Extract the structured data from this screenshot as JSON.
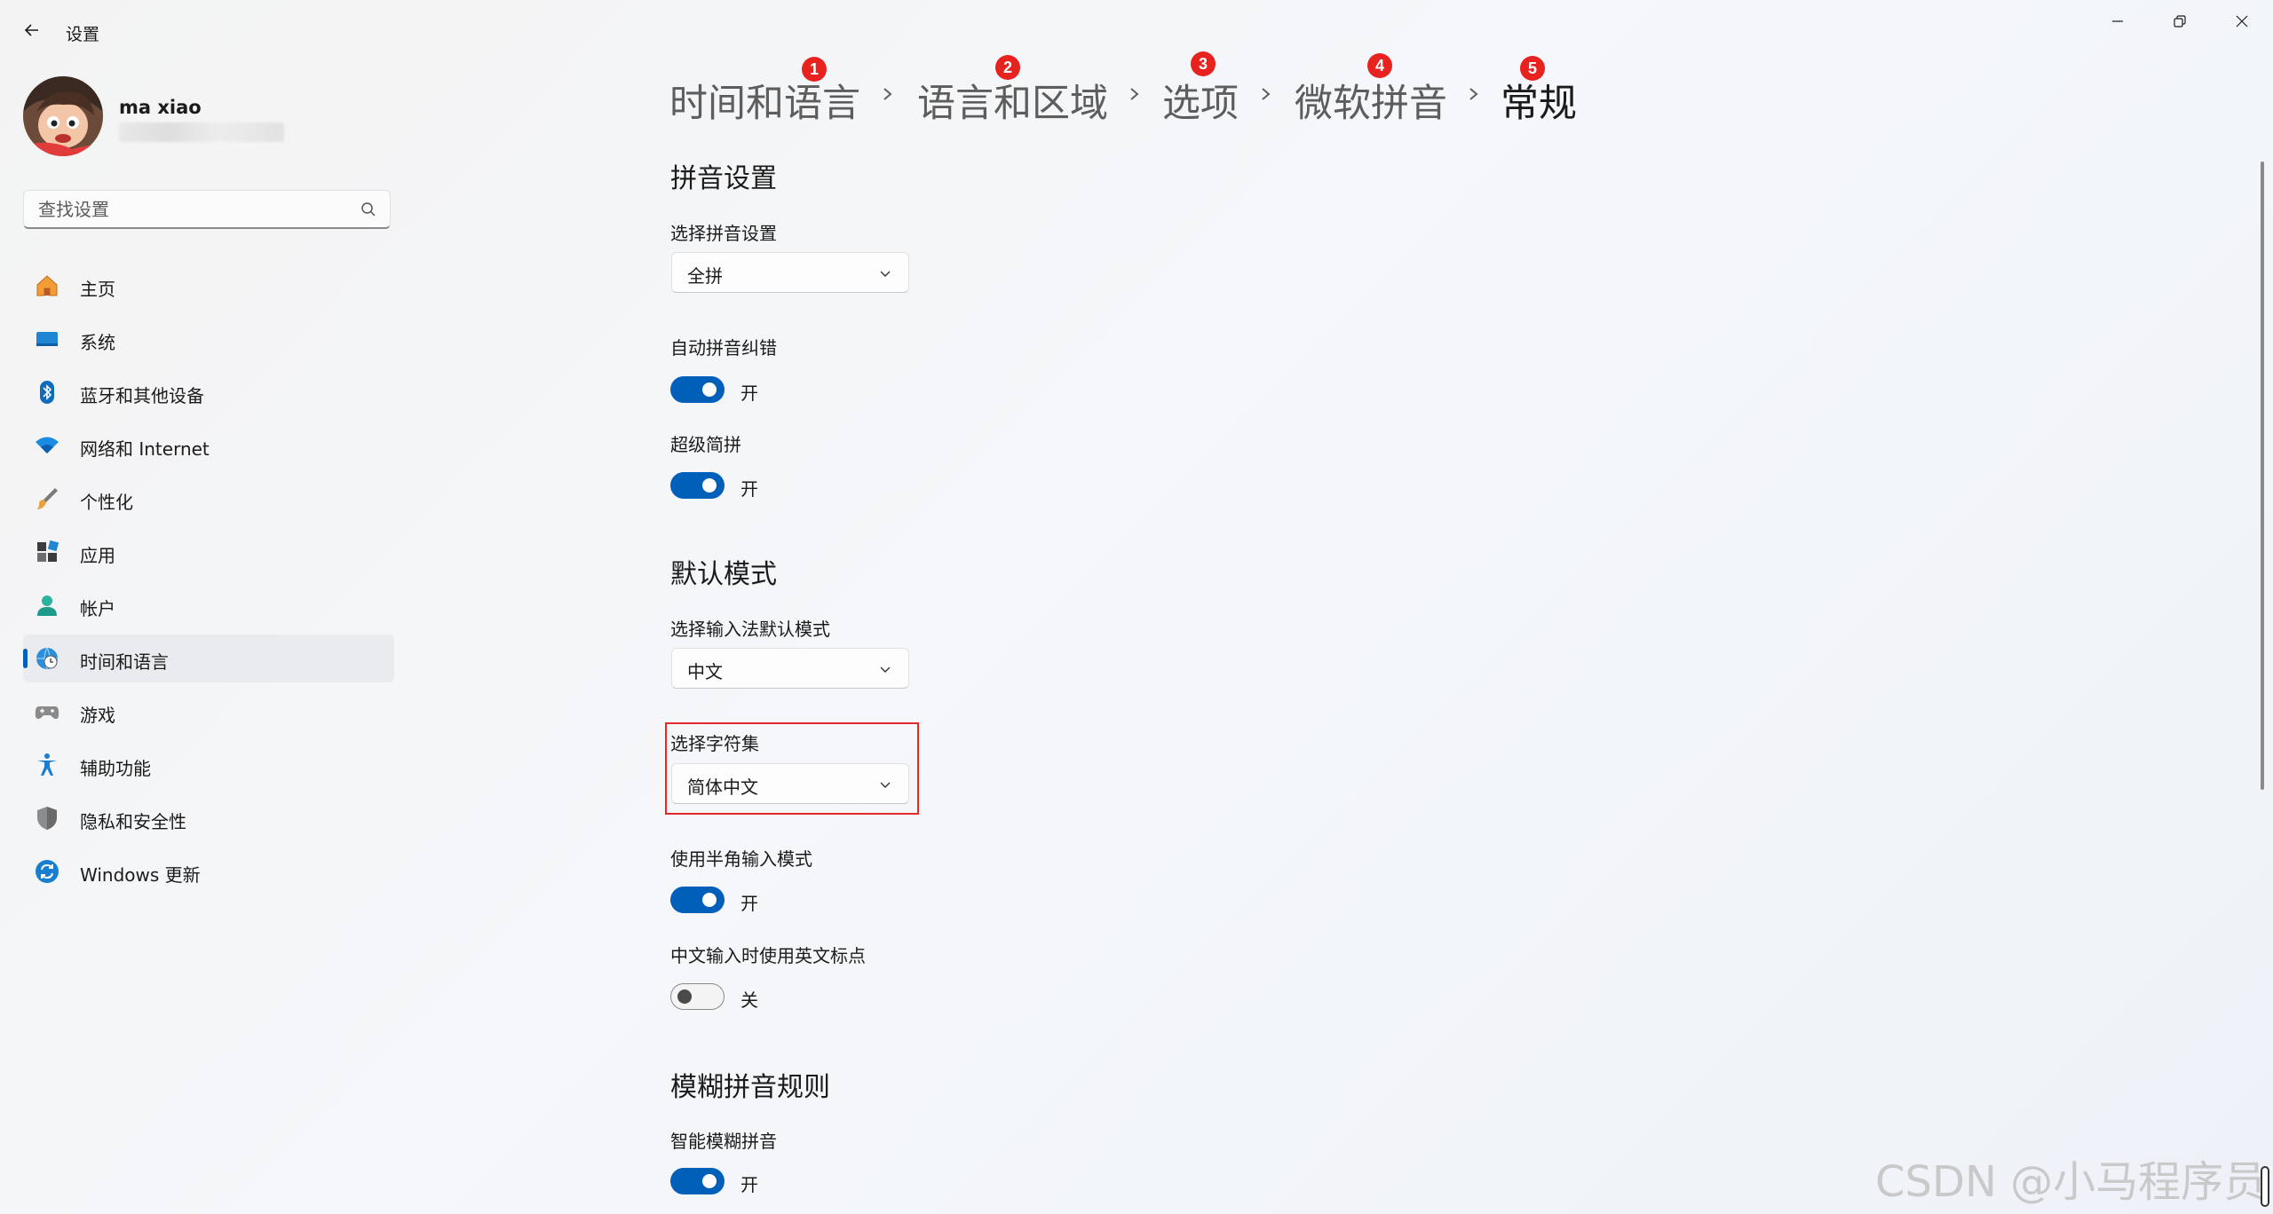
{
  "window": {
    "title": "设置"
  },
  "profile": {
    "name": "ma xiao"
  },
  "search": {
    "placeholder": "查找设置"
  },
  "sidebar": {
    "items": [
      {
        "label": "主页",
        "icon": "home-icon"
      },
      {
        "label": "系统",
        "icon": "monitor-icon"
      },
      {
        "label": "蓝牙和其他设备",
        "icon": "bluetooth-icon"
      },
      {
        "label": "网络和 Internet",
        "icon": "wifi-icon"
      },
      {
        "label": "个性化",
        "icon": "brush-icon"
      },
      {
        "label": "应用",
        "icon": "apps-icon"
      },
      {
        "label": "帐户",
        "icon": "person-icon"
      },
      {
        "label": "时间和语言",
        "icon": "globe-clock-icon",
        "active": true
      },
      {
        "label": "游戏",
        "icon": "gamepad-icon"
      },
      {
        "label": "辅助功能",
        "icon": "accessibility-icon"
      },
      {
        "label": "隐私和安全性",
        "icon": "shield-icon"
      },
      {
        "label": "Windows 更新",
        "icon": "update-icon"
      }
    ]
  },
  "breadcrumb": [
    {
      "label": "时间和语言",
      "badge": "1"
    },
    {
      "label": "语言和区域",
      "badge": "2"
    },
    {
      "label": "选项",
      "badge": "3"
    },
    {
      "label": "微软拼音",
      "badge": "4"
    },
    {
      "label": "常规",
      "badge": "5"
    }
  ],
  "pinyin": {
    "section_title": "拼音设置",
    "scheme_label": "选择拼音设置",
    "scheme_value": "全拼",
    "autocorrect_label": "自动拼音纠错",
    "autocorrect_state": "开",
    "super_abbr_label": "超级简拼",
    "super_abbr_state": "开"
  },
  "default_mode": {
    "section_title": "默认模式",
    "mode_label": "选择输入法默认模式",
    "mode_value": "中文",
    "charset_label": "选择字符集",
    "charset_value": "简体中文",
    "halfwidth_label": "使用半角输入模式",
    "halfwidth_state": "开",
    "eng_punct_label": "中文输入时使用英文标点",
    "eng_punct_state": "关"
  },
  "fuzzy": {
    "section_title": "模糊拼音规则",
    "smart_label": "智能模糊拼音",
    "smart_state": "开"
  },
  "watermark": "CSDN @小马程序员",
  "colors": {
    "accent": "#005fb8",
    "annotation_red": "#e22a2a"
  }
}
